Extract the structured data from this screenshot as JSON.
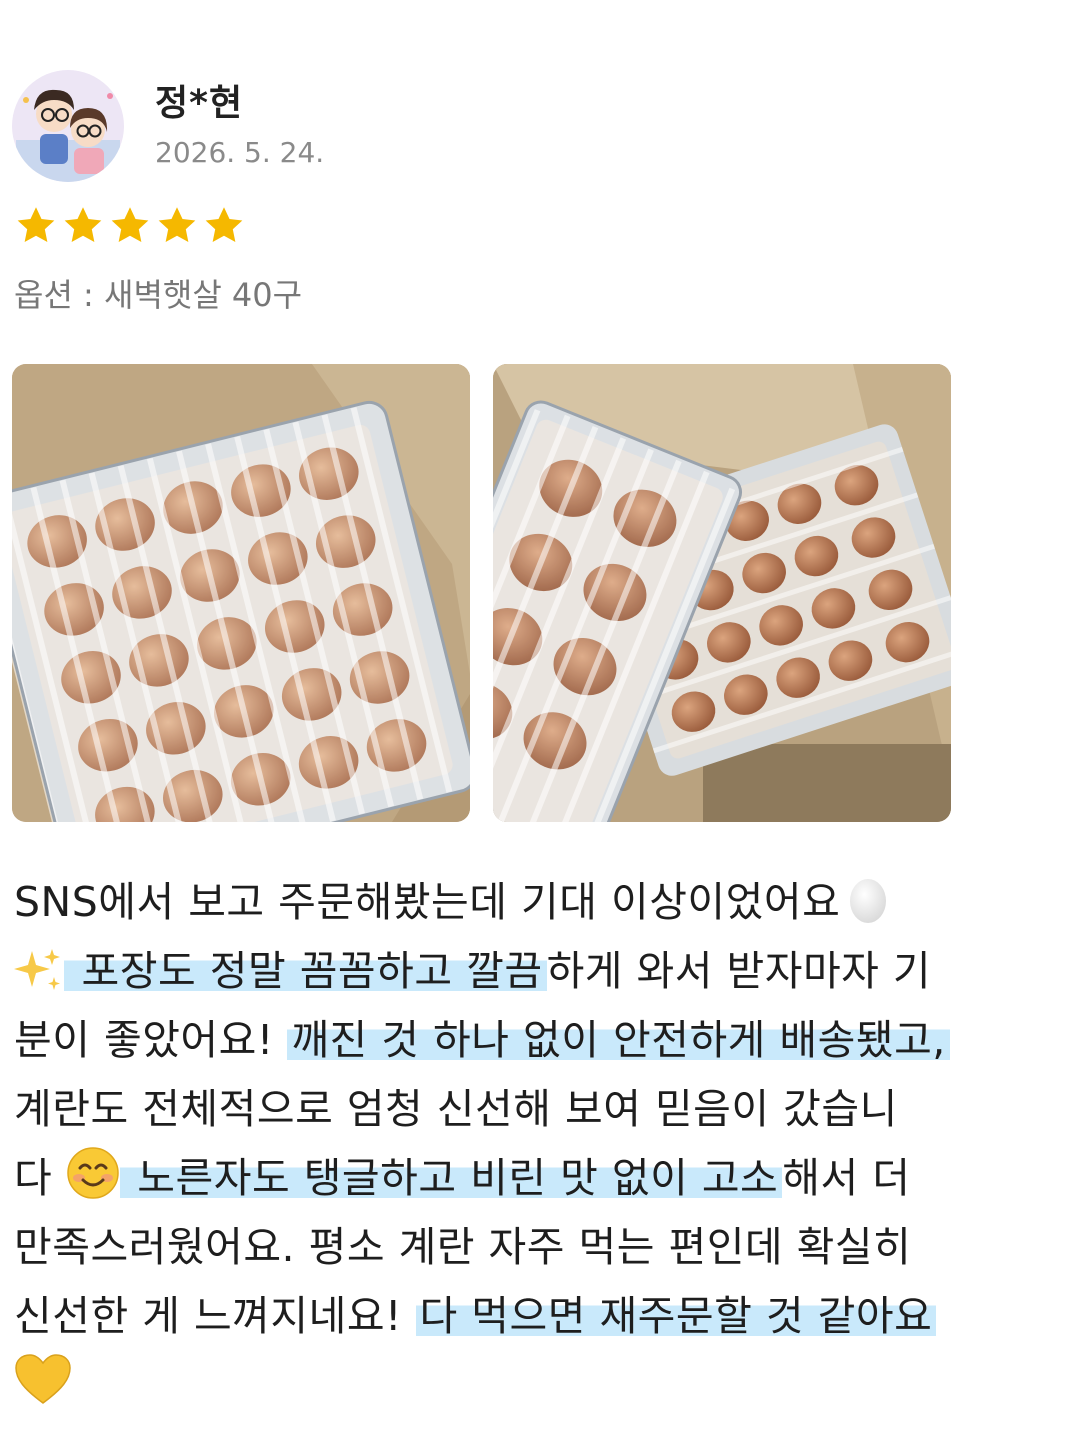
{
  "review": {
    "user": {
      "avatar_icon": "couple-illustration-avatar-icon",
      "name": "정*현",
      "date": "2026. 5. 24."
    },
    "rating": {
      "value": 5,
      "max": 5,
      "star_color": "#F5B800"
    },
    "option_text": "옵션 : 새벽햇살 40구",
    "photos": [
      {
        "icon": "egg-tray-photo-1"
      },
      {
        "icon": "egg-tray-photo-2"
      }
    ],
    "highlight_color": "#C9E9FB",
    "text_lines": [
      {
        "parts": [
          "SNS에서 보고 주문해봤는데 기대 이상이었어요"
        ],
        "emoji_end": "egg-emoji"
      },
      {
        "emoji_start": "sparkles-emoji",
        "highlight": " 포장도 정말 꼼꼼하고 깔끔",
        "rest": "하게 와서 받자마자 기"
      },
      {
        "plain": "분이 좋았어요! ",
        "highlight": "깨진 것 하나 없이 안전하게 배송됐고,"
      },
      {
        "plain": "계란도 전체적으로 엄청 신선해 보여 믿음이 갔습니"
      },
      {
        "plain": "다 ",
        "emoji_mid": "smile-emoji",
        "highlight": " 노른자도 탱글하고 비린 맛 없이 고소",
        "rest": "해서 더"
      },
      {
        "plain": "만족스러웠어요. 평소 계란 자주 먹는 편인데 확실히"
      },
      {
        "plain": "신선한 게 느껴지네요! ",
        "highlight": "다 먹으면 재주문할 것 같아요"
      },
      {
        "emoji_start": "yellow-heart-emoji"
      }
    ]
  }
}
